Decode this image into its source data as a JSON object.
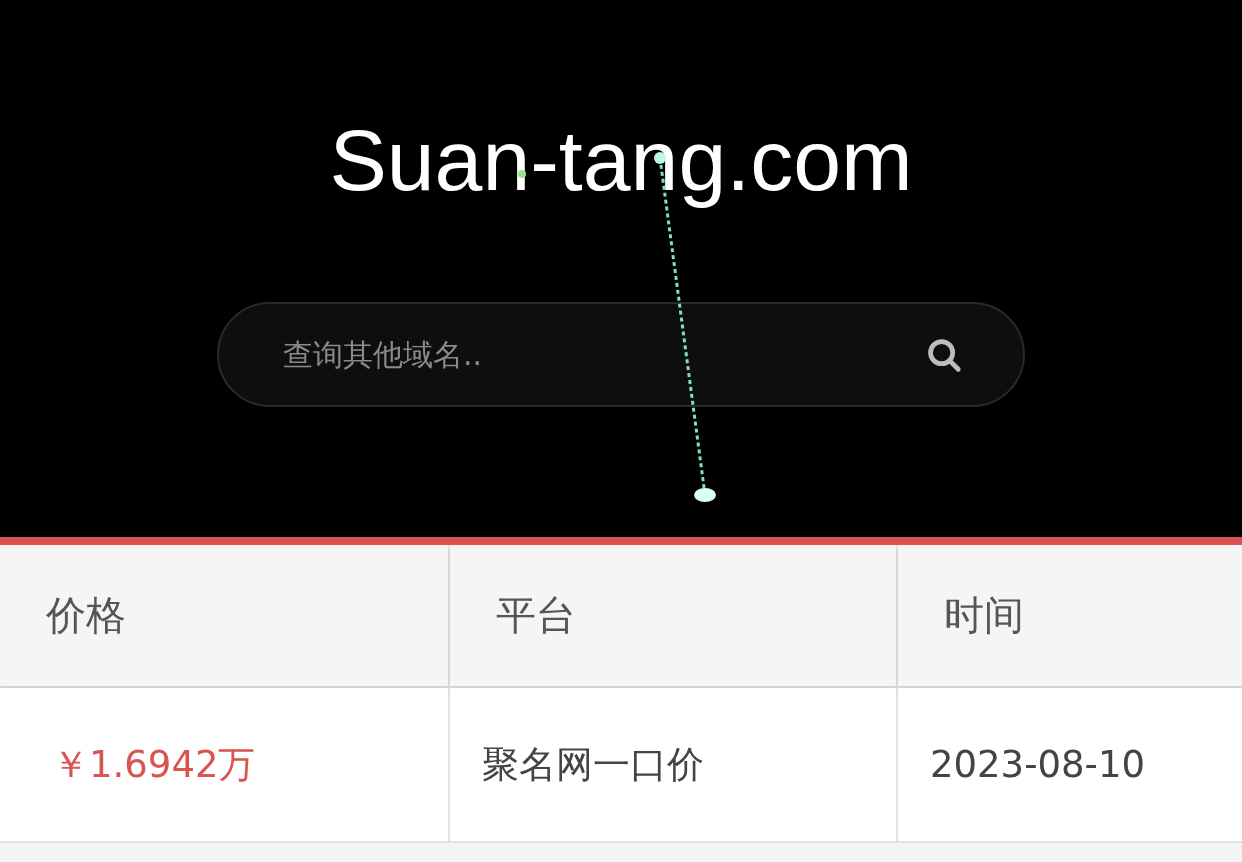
{
  "site_title": "Suan-tang.com",
  "search": {
    "placeholder": "查询其他域名.."
  },
  "table": {
    "columns": [
      "价格",
      "平台",
      "时间"
    ],
    "rows": [
      {
        "cells": [
          "￥1.6942万",
          "聚名网一口价",
          "2023-08-10"
        ]
      }
    ]
  }
}
